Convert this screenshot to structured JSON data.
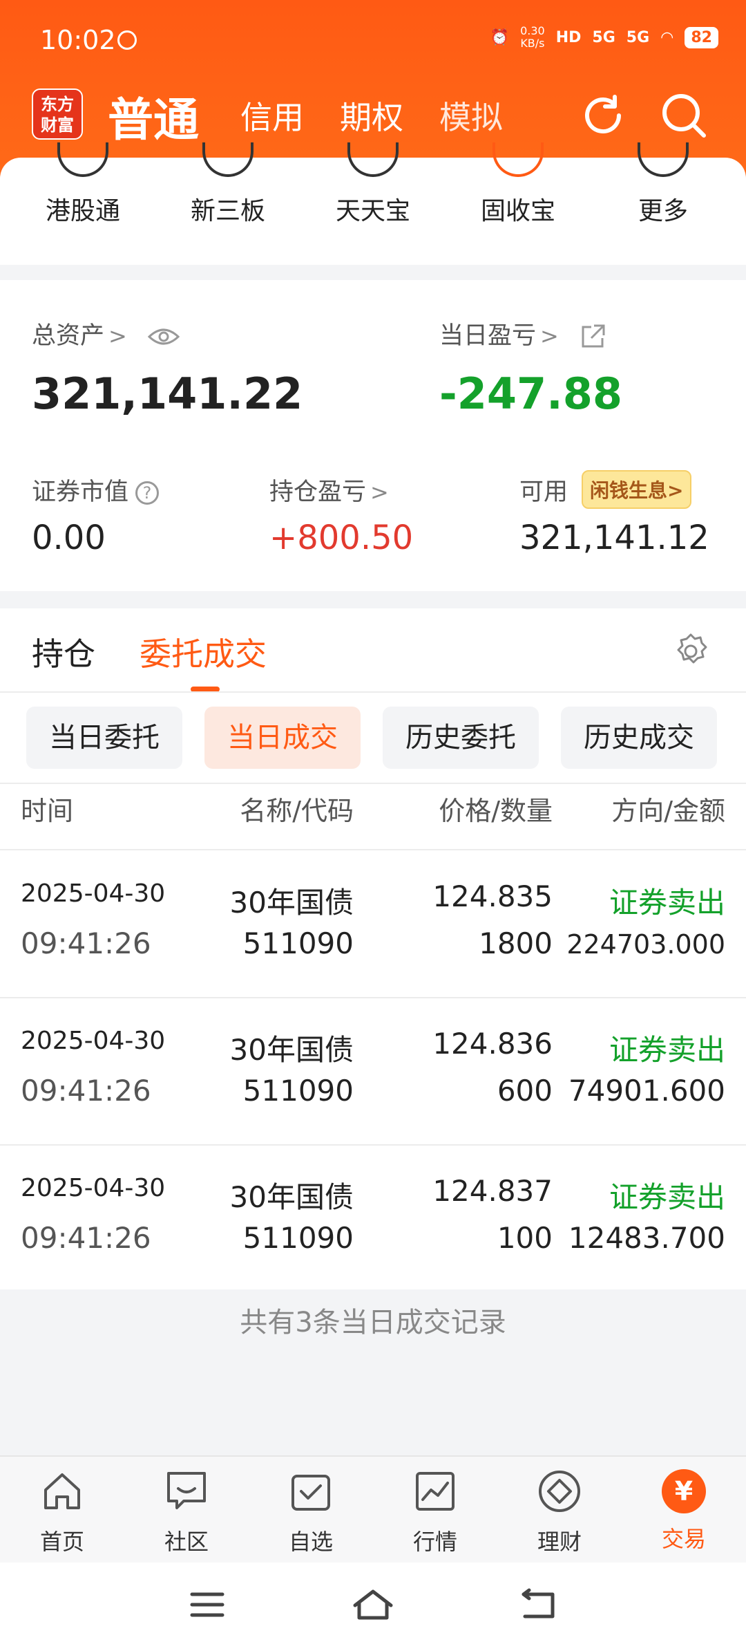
{
  "status_bar": {
    "time": "10:02",
    "net_speed_value": "0.30",
    "net_speed_unit": "KB/s",
    "hd": "HD",
    "net1": "5G",
    "net2": "5G",
    "battery": "82"
  },
  "nav": {
    "logo_line1": "东方",
    "logo_line2": "财富",
    "tabs": [
      "普通",
      "信用",
      "期权",
      "模拟"
    ],
    "active_tab": "普通"
  },
  "quick_entries": [
    "港股通",
    "新三板",
    "天天宝",
    "固收宝",
    "更多"
  ],
  "assets": {
    "total_label": "总资产",
    "total_value": "321,141.22",
    "daily_pl_label": "当日盈亏",
    "daily_pl_value": "-247.88",
    "market_value_label": "证券市值",
    "market_value": "0.00",
    "position_pl_label": "持仓盈亏",
    "position_pl_value": "+800.50",
    "available_label": "可用",
    "available_badge": "闲钱生息>",
    "available_value": "321,141.12",
    "qmark": "?"
  },
  "orders": {
    "main_tabs": [
      "持仓",
      "委托成交"
    ],
    "active_main_tab": "委托成交",
    "sub_tabs": [
      "当日委托",
      "当日成交",
      "历史委托",
      "历史成交"
    ],
    "active_sub_tab": "当日成交",
    "headers": [
      "时间",
      "名称/代码",
      "价格/数量",
      "方向/金额"
    ],
    "rows": [
      {
        "date": "2025-04-30",
        "time": "09:41:26",
        "name": "30年国债",
        "code": "511090",
        "price": "124.835",
        "qty": "1800",
        "direction": "证券卖出",
        "amount": "224703.000"
      },
      {
        "date": "2025-04-30",
        "time": "09:41:26",
        "name": "30年国债",
        "code": "511090",
        "price": "124.836",
        "qty": "600",
        "direction": "证券卖出",
        "amount": "74901.600"
      },
      {
        "date": "2025-04-30",
        "time": "09:41:26",
        "name": "30年国债",
        "code": "511090",
        "price": "124.837",
        "qty": "100",
        "direction": "证券卖出",
        "amount": "12483.700"
      }
    ],
    "footer_note": "共有3条当日成交记录"
  },
  "bottom_nav": [
    {
      "label": "首页",
      "icon": "home-icon"
    },
    {
      "label": "社区",
      "icon": "chat-icon"
    },
    {
      "label": "自选",
      "icon": "checkbox-icon"
    },
    {
      "label": "行情",
      "icon": "chart-icon"
    },
    {
      "label": "理财",
      "icon": "diamond-icon"
    },
    {
      "label": "交易",
      "icon": "yuan-icon",
      "glyph": "¥"
    }
  ],
  "colors": {
    "brand": "#ff5a14",
    "loss": "#14a12b",
    "gain": "#e23a2e"
  }
}
